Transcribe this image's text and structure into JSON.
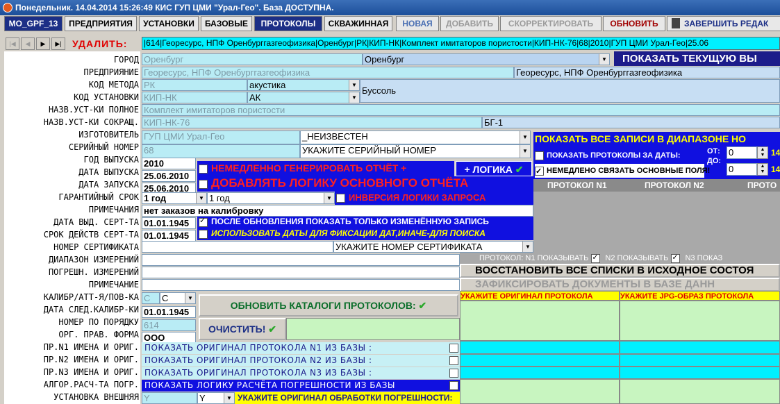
{
  "window": {
    "title": "Понедельник. 14.04.2014 15:26:49  КИС ГУП ЦМИ \"Урал-Гео\". База ДОСТУПНА."
  },
  "toolbar": {
    "tab_mo": "MO_GPF_13",
    "tab_enterprises": "ПРЕДПРИЯТИЯ",
    "tab_installs": "УСТАНОВКИ",
    "tab_base": "БАЗОВЫЕ",
    "tab_protocols": "ПРОТОКОЛЫ",
    "tab_well": "СКВАЖИННАЯ",
    "new": "НОВАЯ",
    "add": "ДОБАВИТЬ",
    "correct": "СКОРРЕКТИРОВАТЬ",
    "refresh": "ОБНОВИТЬ",
    "finish": "ЗАВЕРШИТЬ РЕДАК"
  },
  "nav": {
    "delete": "УДАЛИТЬ:",
    "record": "|614|Георесурс, НПФ Оренбурггазгеофизика|Оренбург|РК|КИП-НК|Комплект имитаторов пористости|КИП-НК-76|68|2010|ГУП ЦМИ Урал-Гео|25.06"
  },
  "labels": {
    "city": "ГОРОД",
    "enterprise": "ПРЕДПРИЯНИЕ",
    "method_code": "КОД МЕТОДА",
    "install_code": "КОД УСТАНОВКИ",
    "install_full": "НАЗВ.УСТ-КИ ПОЛНОЕ",
    "install_short": "НАЗВ.УСТ-КИ СОКРАЩ.",
    "maker": "ИЗГОТОВИТЕЛЬ",
    "serial": "СЕРИЙНЫЙ НОМЕР",
    "year": "ГОД ВЫПУСКА",
    "release_date": "ДАТА ВЫПУСКА",
    "start_date": "ДАТА ЗАПУСКА",
    "warranty": "ГАРАНТИЙНЫЙ СРОК",
    "notes": "ПРИМЕЧАНИЯ",
    "cert_date": "ДАТА ВЫД. СЕРТ-ТА",
    "cert_term": "СРОК ДЕЙСТВ СЕРТ-ТА",
    "cert_number": "НОМЕР СЕРТИФИКАТА",
    "meas_range": "ДИАПАЗОН ИЗМЕРЕНИЙ",
    "meas_error": "ПОГРЕШН. ИЗМЕРЕНИЙ",
    "note2": "ПРИМЕЧАНИЕ",
    "calibr": "КАЛИБР/АТТ-Я/ПОВ-КА",
    "next_calibr": "ДАТА СЛЕД.КАЛИБР-КИ",
    "order_no": "НОМЕР ПО ПОРЯДКУ",
    "org_form": "ОРГ. ПРАВ. ФОРМА",
    "pr1": "ПР.N1 ИМЕНА И ОРИГ.",
    "pr2": "ПР.N2 ИМЕНА И ОРИГ.",
    "pr3": "ПР.N3 ИМЕНА И ОРИГ.",
    "algo": "АЛГОР.РАСЧ-ТА ПОГР.",
    "ext_install": "УСТАНОВКА ВНЕШНЯЯ"
  },
  "values": {
    "city": "Оренбург",
    "city_select": "Оренбург",
    "enterprise": "Георесурс, НПФ Оренбурггазгеофизика",
    "enterprise_right": "Георесурс, НПФ Оренбурггазгеофизика",
    "method_code": "РК",
    "method_select": "акустика",
    "install_code": "КИП-НК",
    "install_select": "АК",
    "install_right": "Буссоль",
    "install_full": "Комплект имитаторов пористости",
    "install_short": "КИП-НК-76",
    "install_short_right": "БГ-1",
    "maker": "ГУП ЦМИ Урал-Гео",
    "maker_select": "_НЕИЗВЕСТЕН",
    "serial": "68",
    "serial_select": "УКАЖИТЕ СЕРИЙНЫЙ НОМЕР",
    "year": "2010",
    "release_date": "25.06.2010",
    "start_date": "25.06.2010",
    "warranty": "1 год",
    "warranty_select": "1 год",
    "notes": "нет заказов на калибровку",
    "cert_date": "01.01.1945",
    "cert_term": "01.01.1945",
    "cert_select": "УКАЖИТЕ НОМЕР СЕРТИФИКАТА",
    "calibr": "С",
    "calibr_select": "С",
    "next_calibr": "01.01.1945",
    "order_no": "614",
    "org_form": "ООО",
    "ext_install": "Y",
    "ext_select": "Y"
  },
  "options": {
    "gen_report": "НЕМЕДЛЕННО ГЕНЕРИРОВАТЬ ОТЧЁТ +",
    "logic_btn": "+ ЛОГИКА",
    "add_logic": "ДОБАВЛЯТЬ ЛОГИКУ ОСНОВНОГО ОТЧЁТА",
    "invert": "ИНВЕРСИЯ ЛОГИКИ ЗАПРОСА",
    "after_update": "ПОСЛЕ ОБНОВЛЕНИЯ ПОКАЗАТЬ ТОЛЬКО ИЗМЕНЁННУЮ ЗАПИСЬ",
    "use_dates": "ИСПОЛЬЗОВАТЬ ДАТЫ ДЛЯ ФИКСАЦИИ ДАТ,ИНАЧЕ-ДЛЯ ПОИСКА",
    "refresh_catalogs": "ОБНОВИТЬ КАТАЛОГИ ПРОТОКОЛОВ:",
    "clear": "ОЧИСТИТЬ!",
    "show_orig1": "ПОКАЗАТЬ ОРИГИНАЛ ПРОТОКОЛА N1 ИЗ БАЗЫ :",
    "show_orig2": "ПОКАЗАТЬ ОРИГИНАЛ ПРОТОКОЛА N2 ИЗ БАЗЫ :",
    "show_orig3": "ПОКАЗАТЬ ОРИГИНАЛ ПРОТОКОЛА N3 ИЗ БАЗЫ :",
    "show_logic": "ПОКАЗАТЬ ЛОГИКУ РАСЧЁТА ПОГРЕШНОСТИ ИЗ БАЗЫ",
    "orig_err": "УКАЖИТЕ ОРИГИНАЛ ОБРАБОТКИ ПОГРЕШНОСТИ:"
  },
  "right": {
    "show_current": "ПОКАЗАТЬ ТЕКУЩУЮ ВЫ",
    "show_all": "ПОКАЗАТЬ ВСЕ ЗАПИСИ В ДИАПАЗОНЕ НО",
    "show_protocols_dates": "ПОКАЗАТЬ ПРОТОКОЛЫ ЗА ДАТЫ:",
    "from": "ОТ:",
    "to": "ДО:",
    "from_val": "0",
    "to_val": "0",
    "from_side": "14",
    "to_side": "14",
    "link_fields": "НЕМЕДЛЕНО СВЯЗАТЬ ОСНОВНЫЕ ПОЛЯ!",
    "col1": "ПРОТОКОЛ N1",
    "col2": "ПРОТОКОЛ N2",
    "col3": "ПРОТО",
    "show_flags": "ПРОТОКОЛ: N1 ПОКАЗЫВАТЬ",
    "n2_show": "N2 ПОКАЗЫВАТЬ",
    "n3_show": "N3 ПОКАЗ",
    "restore": "ВОССТАНОВИТЬ ВСЕ СПИСКИ В ИСХОДНОЕ СОСТОЯ",
    "fix_docs": "ЗАФИКСИРОВАТЬ ДОКУМЕНТЫ В БАЗЕ ДАНН",
    "orig_hdr": "УКАЖИТЕ ОРИГИНАЛ ПРОТОКОЛА",
    "jpg_hdr": "УКАЖИТЕ JPG-ОБРАЗ ПРОТОКОЛА"
  }
}
